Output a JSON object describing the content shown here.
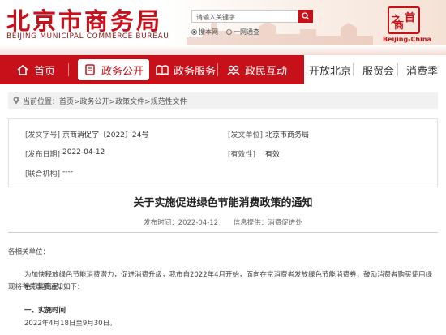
{
  "header": {
    "title_cn": "北京市商务局",
    "title_en": "BEIJING MUNICIPAL COMMERCE BUREAU",
    "search_placeholder": "请输入关键字",
    "scope_options": [
      "搜本网",
      "一网通查"
    ],
    "scope_selected": 0,
    "logo_text": "Beijing-China",
    "logo_glyphs": [
      "首",
      "之",
      "商"
    ],
    "accent_color": "#c8101a"
  },
  "nav": {
    "items": [
      {
        "label": "首页",
        "icon": "home-icon",
        "active": false
      },
      {
        "label": "政务公开",
        "icon": "document-icon",
        "active": true
      },
      {
        "label": "政务服务",
        "icon": "book-icon",
        "active": false
      },
      {
        "label": "政民互动",
        "icon": "people-icon",
        "active": false
      }
    ],
    "right_items": [
      "开放北京",
      "服贸会",
      "消费季"
    ]
  },
  "breadcrumb": {
    "prefix": "当前位置：",
    "path": "首页>政务公开>政策文件>规范性文件"
  },
  "info": {
    "doc_no_label": "[发文字号]",
    "doc_no_value": "京商消促字〔2022〕24号",
    "issuer_label": "[发文单位]",
    "issuer_value": "北京市商务局",
    "date_label": "[发布日期]",
    "date_value": "2022-04-12",
    "validity_label": "[有效性]",
    "validity_value": "有效",
    "joint_label": "[联合机构]",
    "joint_value": "----"
  },
  "document": {
    "title": "关于实施促进绿色节能消费政策的通知",
    "publish_label": "发布时间：2022-04-12",
    "source_label": "信息提供：消费促进处",
    "greeting": "各相关单位：",
    "paragraph1_line1": "为加快释放绿色节能消费潜力，促进消费升级，我市自2022年4月开始，面向在京消费者发放绿色节能消费券，鼓励消费者购买使用绿色节能商品。",
    "paragraph1_line2": "现将有关事项通知如下：",
    "section1_heading": "一、实施时间",
    "section1_text": "2022年4月18日至9月30日。"
  }
}
